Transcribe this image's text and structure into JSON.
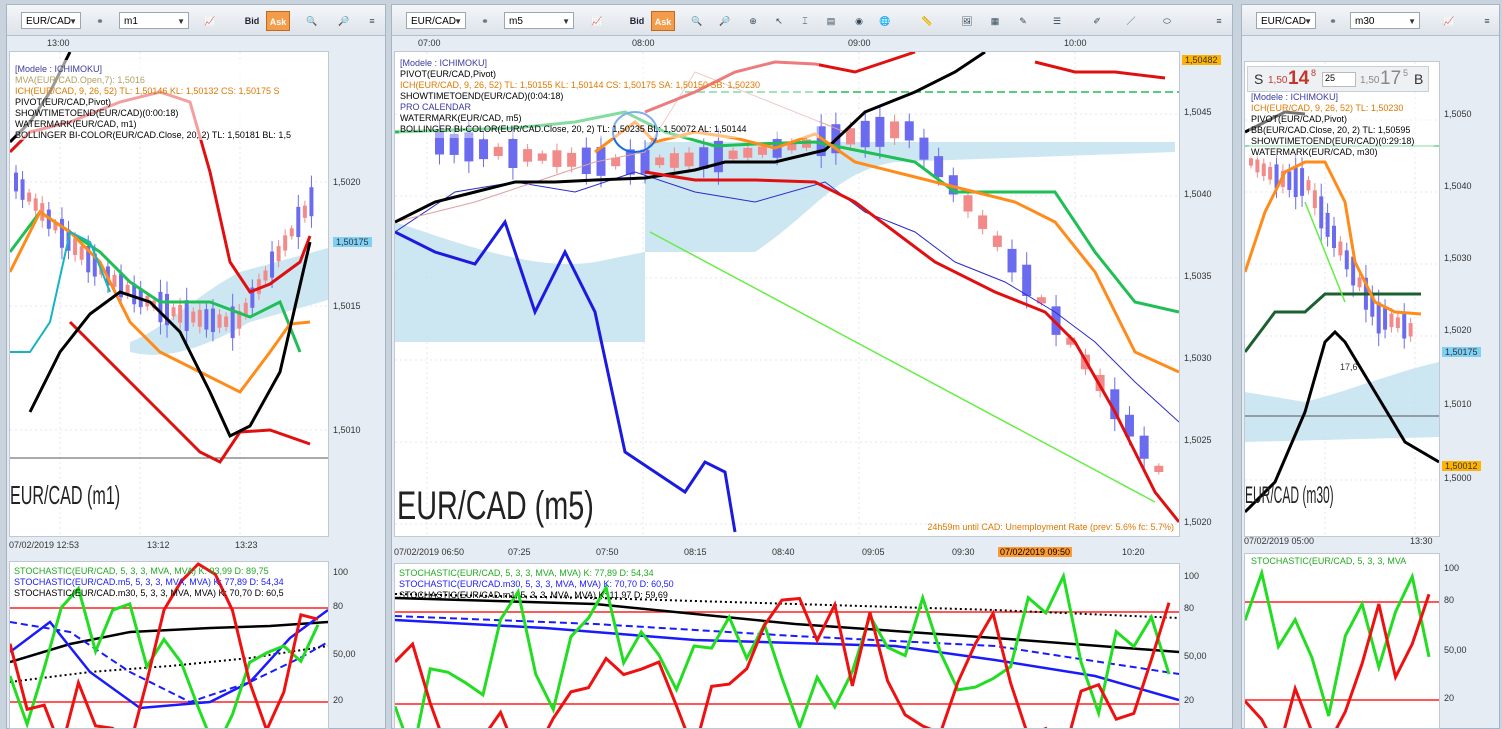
{
  "panels": {
    "left": {
      "symbol": "EUR/CAD",
      "timeframe": "m1",
      "bid": "Bid",
      "ask": "Ask",
      "top_time": "13:00",
      "bottom_times": [
        "07/02/2019 12:53",
        "13:12",
        "13:23"
      ],
      "prices": [
        "1,5020",
        "1,5015",
        "1,5010"
      ],
      "price_tag": "1,50175",
      "legend": [
        {
          "text": "[Modele : ICHIMOKU]",
          "color": "#3a3aa0"
        },
        {
          "text": "MVA(EUR/CAD.Open,7): 1,5016",
          "color": "#b0a060"
        },
        {
          "text": "ICH(EUR/CAD, 9, 26, 52)  TL: 1,50146  KL: 1,50132  CS: 1,50175  S",
          "color": "#e07800"
        },
        {
          "text": "PIVOT(EUR/CAD,Pivot)",
          "color": "#000"
        },
        {
          "text": "SHOWTIMETOEND(EUR/CAD)(0:00:18)",
          "color": "#000"
        },
        {
          "text": "WATERMARK(EUR/CAD, m1)",
          "color": "#000"
        },
        {
          "text": "BOLLINGER BI-COLOR(EUR/CAD.Close, 20, 2)  TL: 1,50181  BL: 1,5",
          "color": "#000"
        }
      ],
      "watermark": "EUR/CAD (m1)",
      "stoch_legend": [
        {
          "text": "STOCHASTIC(EUR/CAD, 5, 3, 3, MVA, MVA)  K: 93,99  D: 89,75",
          "color": "#22aa22"
        },
        {
          "text": "STOCHASTIC(EUR/CAD.m5, 5, 3, 3, MVA, MVA)  K: 77,89  D: 54,34",
          "color": "#1a1aff"
        },
        {
          "text": "STOCHASTIC(EUR/CAD.m30, 5, 3, 3, MVA, MVA)  K: 70,70  D: 60,5",
          "color": "#000"
        }
      ],
      "stoch_levels": [
        "100",
        "80",
        "50,00",
        "20"
      ]
    },
    "middle": {
      "symbol": "EUR/CAD",
      "timeframe": "m5",
      "bid": "Bid",
      "ask": "Ask",
      "top_times": [
        "07:00",
        "08:00",
        "09:00",
        "10:00"
      ],
      "bottom_times": [
        "07/02/2019 06:50",
        "07:25",
        "07:50",
        "08:15",
        "08:40",
        "09:05",
        "09:30",
        "07/02/2019 09:50",
        "10:20"
      ],
      "prices": [
        "1,5045",
        "1,5040",
        "1,5035",
        "1,5030",
        "1,5025",
        "1,5020"
      ],
      "price_tag": "1,50482",
      "legend": [
        {
          "text": "[Modele : ICHIMOKU]",
          "color": "#3a3aa0"
        },
        {
          "text": "PIVOT(EUR/CAD,Pivot)",
          "color": "#000"
        },
        {
          "text": "ICH(EUR/CAD, 9, 26, 52)  TL: 1,50155  KL: 1,50144  CS: 1,50175  SA: 1,50150  SB: 1,50230",
          "color": "#e07800"
        },
        {
          "text": "SHOWTIMETOEND(EUR/CAD)(0:04:18)",
          "color": "#000"
        },
        {
          "text": "PRO CALENDAR",
          "color": "#3a3aa0"
        },
        {
          "text": "WATERMARK(EUR/CAD, m5)",
          "color": "#000"
        },
        {
          "text": "BOLLINGER BI-COLOR(EUR/CAD.Close, 20, 2)  TL: 1,50235  BL: 1,50072  AL: 1,50144",
          "color": "#000"
        }
      ],
      "watermark": "EUR/CAD (m5)",
      "news": "24h59m until CAD: Unemployment Rate (prev: 5.6% fc: 5.7%)",
      "stoch_legend": [
        {
          "text": "STOCHASTIC(EUR/CAD, 5, 3, 3, MVA, MVA)  K: 77,89  D: 54,34",
          "color": "#22aa22"
        },
        {
          "text": "STOCHASTIC(EUR/CAD.m30, 5, 3, 3, MVA, MVA)  K: 70,70  D: 60,50",
          "color": "#1a1aff"
        },
        {
          "text": "STOCHASTIC(EUR/CAD.m1, 5, 3, 3, MVA, MVA)  K: 11,97  D: 59,69",
          "color": "#000"
        }
      ],
      "stoch_levels": [
        "100",
        "80",
        "50,00",
        "20"
      ]
    },
    "right": {
      "symbol": "EUR/CAD",
      "timeframe": "m30",
      "bottom_times": [
        "07/02/2019 05:00",
        "13:30"
      ],
      "prices": [
        "1,5050",
        "1,5040",
        "1,5030",
        "1,5020",
        "1,5010",
        "1,5000"
      ],
      "price_tag": "1,50175",
      "price_tag2": "1,50012",
      "quote": {
        "sell_label": "S",
        "sell_prefix": "1,50",
        "sell_big": "14",
        "sell_sup": "8",
        "qty": "25",
        "buy_prefix": "1,50",
        "buy_big": "17",
        "buy_sup": "5",
        "buy_label": "B"
      },
      "legend": [
        {
          "text": "[Modele : ICHIMOKU]",
          "color": "#3a3aa0"
        },
        {
          "text": "ICH(EUR/CAD, 9, 26, 52)  TL: 1,50230",
          "color": "#e07800"
        },
        {
          "text": "PIVOT(EUR/CAD,Pivot)",
          "color": "#000"
        },
        {
          "text": "BB(EUR/CAD.Close, 20, 2)  TL: 1,50595",
          "color": "#000"
        },
        {
          "text": "SHOWTIMETOEND(EUR/CAD)(0:29:18)",
          "color": "#000"
        },
        {
          "text": "WATERMARK(EUR/CAD, m30)",
          "color": "#000"
        }
      ],
      "watermark": "EUR/CAD (m30)",
      "marker": "17,6",
      "stoch_legend": [
        {
          "text": "STOCHASTIC(EUR/CAD, 5, 3, 3, MVA",
          "color": "#22aa22"
        }
      ],
      "stoch_levels": [
        "100",
        "80",
        "50,00",
        "20"
      ]
    }
  },
  "colors": {
    "ask": "#f39c4a",
    "bull": "#6b6bf0",
    "bear": "#f28a8a",
    "cloud": "#bfe0ef",
    "kijun": "#1fbf55",
    "tenkan": "#ff8c1a",
    "bollinger": "#e01010"
  }
}
